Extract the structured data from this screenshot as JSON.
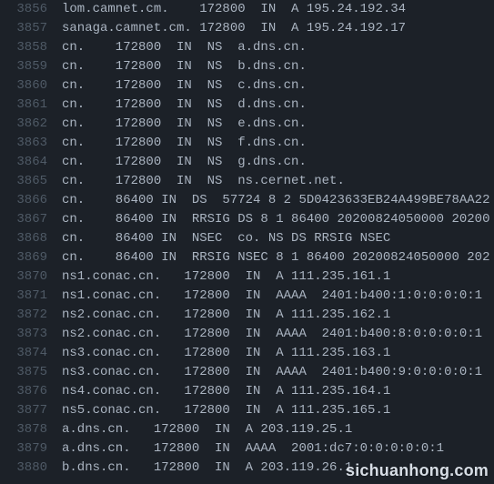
{
  "lines": [
    {
      "no": 3856,
      "text": "lom.camnet.cm.    172800  IN  A 195.24.192.34"
    },
    {
      "no": 3857,
      "text": "sanaga.camnet.cm. 172800  IN  A 195.24.192.17"
    },
    {
      "no": 3858,
      "text": "cn.    172800  IN  NS  a.dns.cn."
    },
    {
      "no": 3859,
      "text": "cn.    172800  IN  NS  b.dns.cn."
    },
    {
      "no": 3860,
      "text": "cn.    172800  IN  NS  c.dns.cn."
    },
    {
      "no": 3861,
      "text": "cn.    172800  IN  NS  d.dns.cn."
    },
    {
      "no": 3862,
      "text": "cn.    172800  IN  NS  e.dns.cn."
    },
    {
      "no": 3863,
      "text": "cn.    172800  IN  NS  f.dns.cn."
    },
    {
      "no": 3864,
      "text": "cn.    172800  IN  NS  g.dns.cn."
    },
    {
      "no": 3865,
      "text": "cn.    172800  IN  NS  ns.cernet.net."
    },
    {
      "no": 3866,
      "text": "cn.    86400 IN  DS  57724 8 2 5D0423633EB24A499BE78AA22"
    },
    {
      "no": 3867,
      "text": "cn.    86400 IN  RRSIG DS 8 1 86400 20200824050000 20200"
    },
    {
      "no": 3868,
      "text": "cn.    86400 IN  NSEC  co. NS DS RRSIG NSEC"
    },
    {
      "no": 3869,
      "text": "cn.    86400 IN  RRSIG NSEC 8 1 86400 20200824050000 202"
    },
    {
      "no": 3870,
      "text": "ns1.conac.cn.   172800  IN  A 111.235.161.1"
    },
    {
      "no": 3871,
      "text": "ns1.conac.cn.   172800  IN  AAAA  2401:b400:1:0:0:0:0:1"
    },
    {
      "no": 3872,
      "text": "ns2.conac.cn.   172800  IN  A 111.235.162.1"
    },
    {
      "no": 3873,
      "text": "ns2.conac.cn.   172800  IN  AAAA  2401:b400:8:0:0:0:0:1"
    },
    {
      "no": 3874,
      "text": "ns3.conac.cn.   172800  IN  A 111.235.163.1"
    },
    {
      "no": 3875,
      "text": "ns3.conac.cn.   172800  IN  AAAA  2401:b400:9:0:0:0:0:1"
    },
    {
      "no": 3876,
      "text": "ns4.conac.cn.   172800  IN  A 111.235.164.1"
    },
    {
      "no": 3877,
      "text": "ns5.conac.cn.   172800  IN  A 111.235.165.1"
    },
    {
      "no": 3878,
      "text": "a.dns.cn.   172800  IN  A 203.119.25.1"
    },
    {
      "no": 3879,
      "text": "a.dns.cn.   172800  IN  AAAA  2001:dc7:0:0:0:0:0:1"
    },
    {
      "no": 3880,
      "text": "b.dns.cn.   172800  IN  A 203.119.26.1"
    }
  ],
  "watermark": "sichuanhong.com"
}
